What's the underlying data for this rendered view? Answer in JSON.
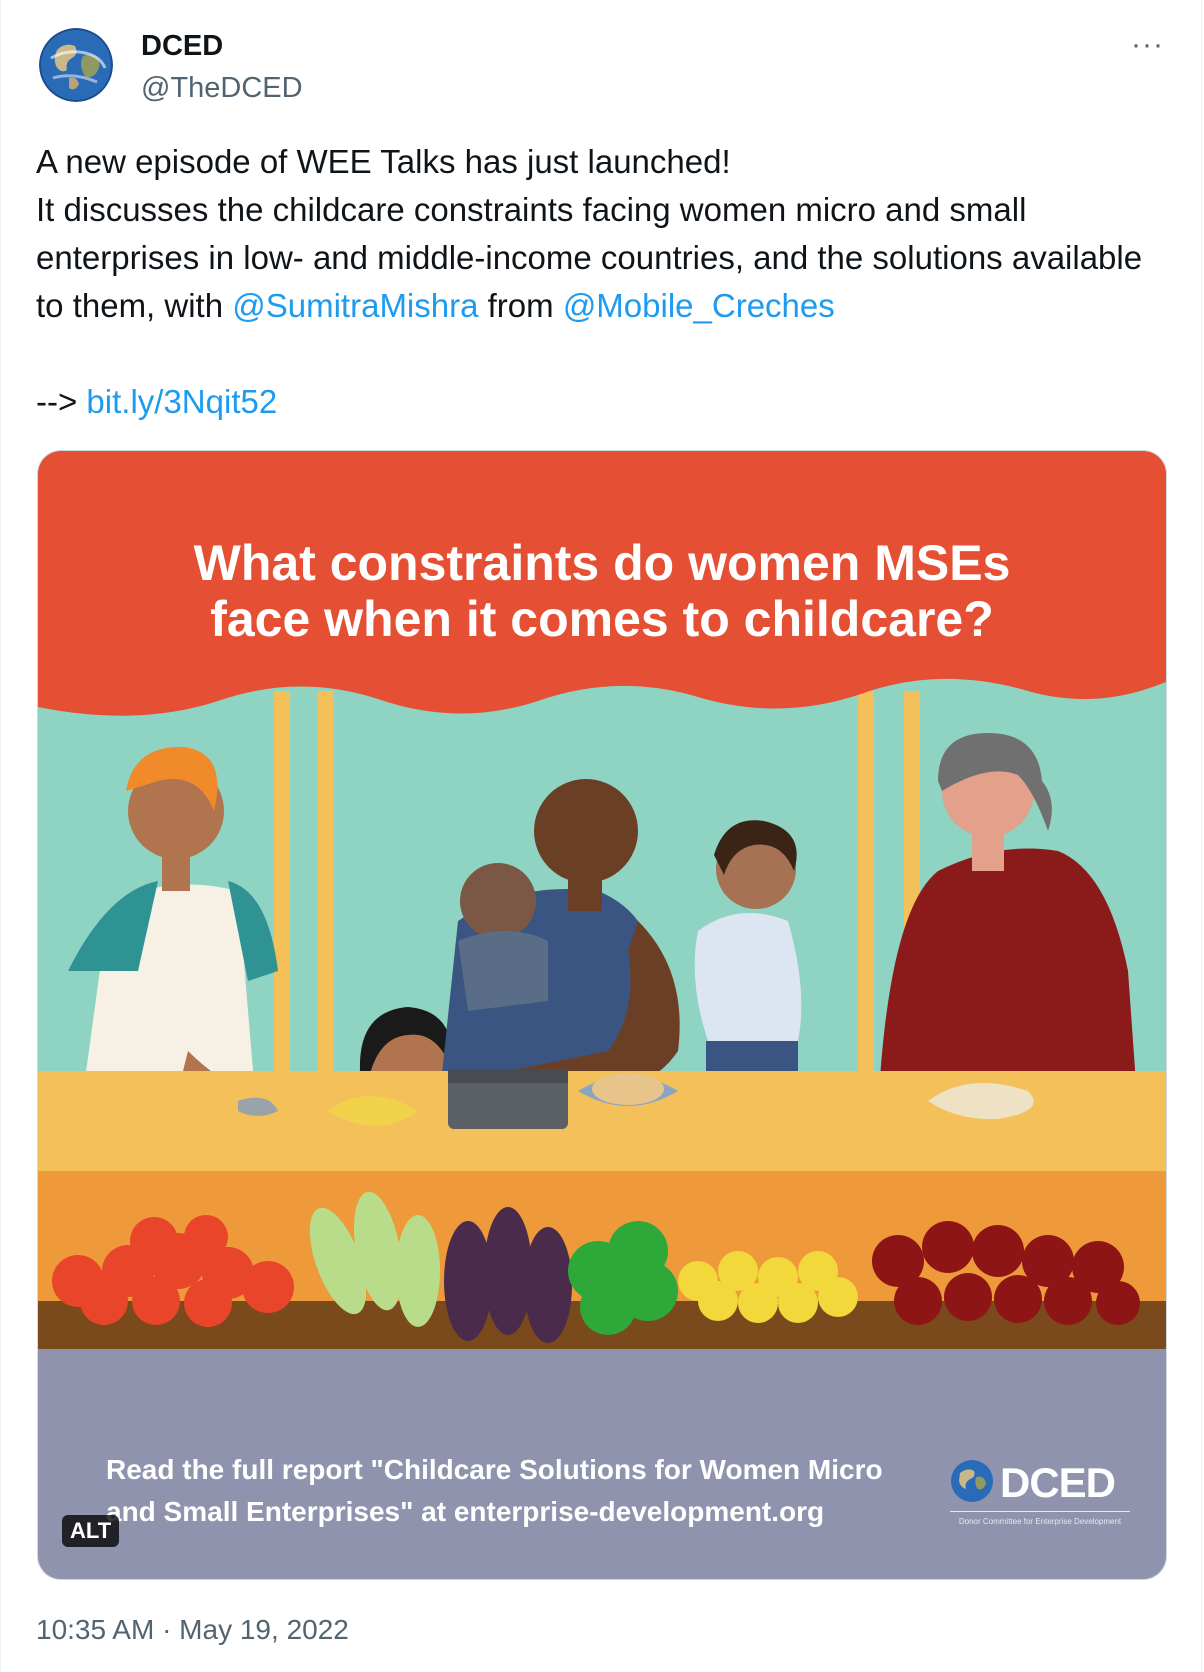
{
  "author": {
    "name": "DCED",
    "handle": "@TheDCED",
    "avatar_icon": "globe-icon"
  },
  "more_label": "···",
  "tweet": {
    "line1": "A new episode of WEE Talks has just launched!",
    "line2_pre": "It discusses the childcare constraints facing women micro and small enterprises in low- and middle-income countries, and the solutions available to them, with ",
    "mention1": "@SumitraMishra",
    "mid": " from ",
    "mention2": "@Mobile_Creches",
    "arrow": "-->",
    "url": "bit.ly/3Nqit52"
  },
  "media": {
    "title_line1": "What constraints do women MSEs",
    "title_line2": "face when it comes to childcare?",
    "footer_line1": "Read the full report \"Childcare Solutions for Women Micro",
    "footer_line2": "and Small Enterprises\" at enterprise-development.org",
    "logo_text": "DCED",
    "logo_sub": "Donor Committee for Enterprise Development",
    "alt_label": "ALT"
  },
  "timestamp": "10:35 AM · May 19, 2022",
  "colors": {
    "link": "#1d9bf0",
    "banner": "#e54f33",
    "sky": "#8fd3c2",
    "counter": "#f4c05a",
    "stall": "#ef9a3a",
    "footer": "#8f93ad"
  }
}
